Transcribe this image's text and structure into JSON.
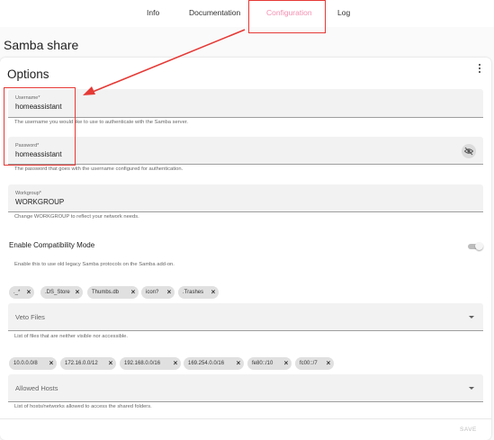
{
  "tabs": [
    {
      "label": "Info"
    },
    {
      "label": "Documentation"
    },
    {
      "label": "Configuration"
    },
    {
      "label": "Log"
    }
  ],
  "page": {
    "title": "Samba share"
  },
  "card": {
    "title": "Options"
  },
  "username": {
    "label": "Username*",
    "value": "homeassistant",
    "helper": "The username you would like to use to authenticate with the Samba server."
  },
  "password": {
    "label": "Password*",
    "value": "homeassistant",
    "helper": "The password that goes with the username configured for authentication."
  },
  "workgroup": {
    "label": "Workgroup*",
    "value": "WORKGROUP",
    "helper": "Change WORKGROUP to reflect your network needs."
  },
  "compat": {
    "label": "Enable Compatibility Mode",
    "helper": "Enable this to use old legacy Samba protocols on the Samba add-on.",
    "enabled": false
  },
  "veto": {
    "chips": [
      "._*",
      ".DS_Store",
      "Thumbs.db",
      "icon?",
      ".Trashes"
    ],
    "label": "Veto Files",
    "helper": "List of files that are neither visible nor accessible."
  },
  "hosts": {
    "chips": [
      "10.0.0.0/8",
      "172.16.0.0/12",
      "192.168.0.0/16",
      "169.254.0.0/16",
      "fe80::/10",
      "fc00::/7"
    ],
    "label": "Allowed Hosts",
    "helper": "List of hosts/networks allowed to access the shared folders."
  },
  "actions": {
    "save": "SAVE"
  },
  "colors": {
    "accent": "#f48fb1",
    "annotation": "#e53935"
  }
}
